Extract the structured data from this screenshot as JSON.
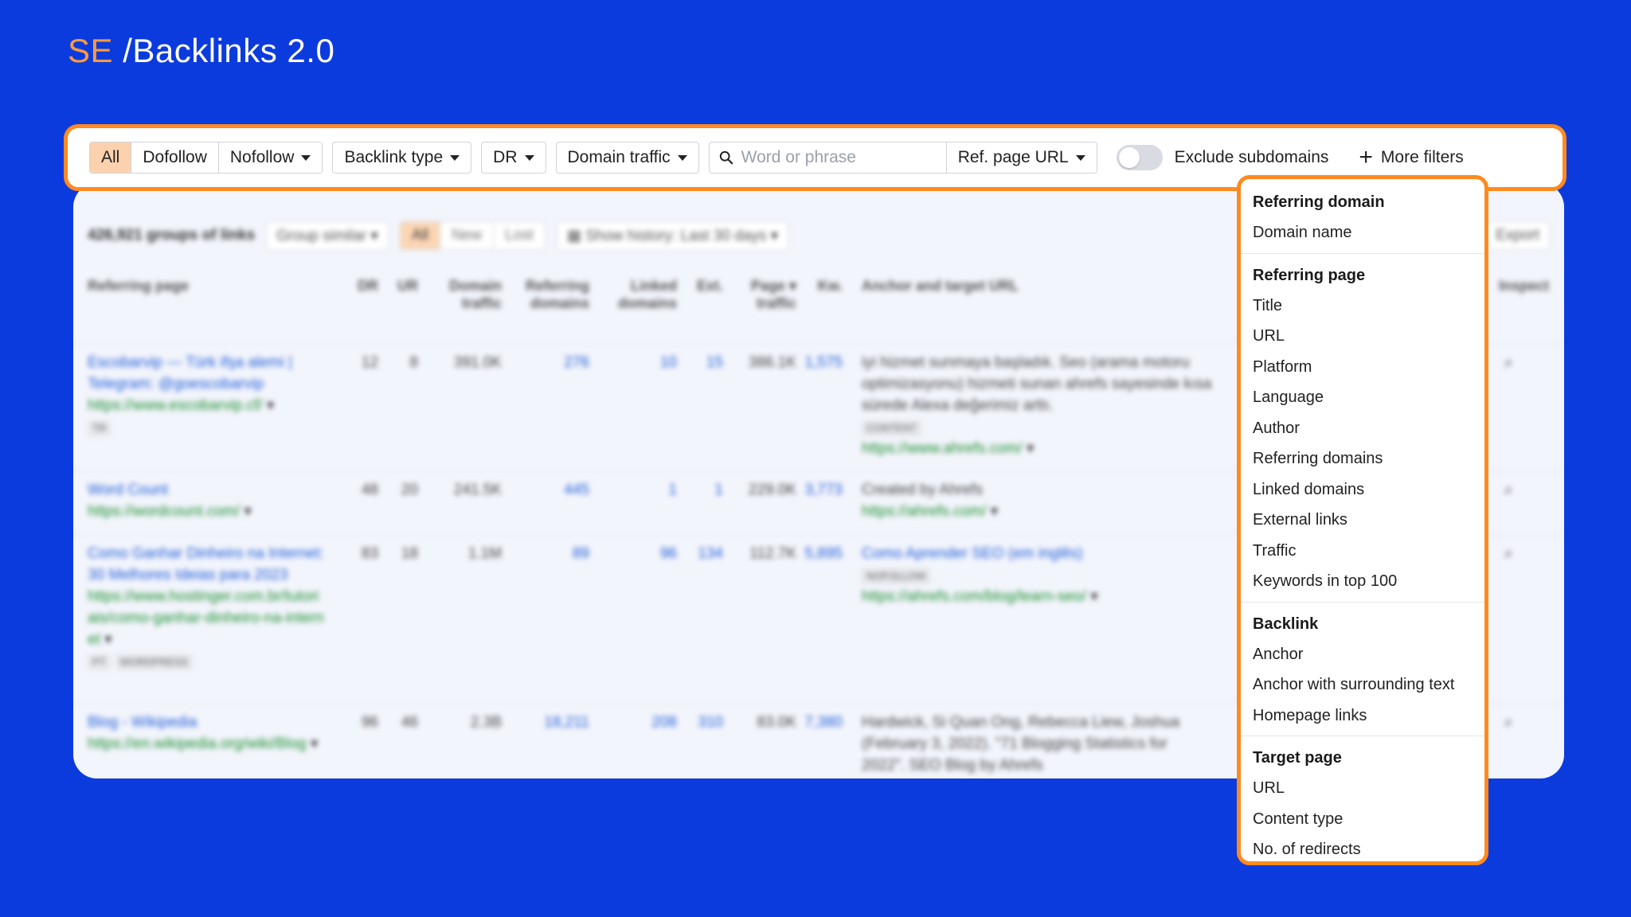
{
  "title": {
    "prefix": "SE",
    "rest": " /Backlinks 2.0"
  },
  "filter_bar": {
    "link_type_segments": [
      "All",
      "Dofollow",
      "Nofollow"
    ],
    "backlink_type": "Backlink type",
    "dr": "DR",
    "domain_traffic": "Domain traffic",
    "search_placeholder": "Word or phrase",
    "search_scope": "Ref. page URL",
    "exclude_subdomains": "Exclude subdomains",
    "more_filters": "More filters"
  },
  "table": {
    "groups_count": "426,921 groups of links",
    "group_similar": "Group similar",
    "status_segments": [
      "All",
      "New",
      "Lost"
    ],
    "history": "Show history: Last 30 days",
    "export": "Export",
    "columns": {
      "referring_page": "Referring page",
      "dr": "DR",
      "ur": "UR",
      "domain_traffic_1": "Domain",
      "domain_traffic_2": "traffic",
      "referring_domains_1": "Referring",
      "referring_domains_2": "domains",
      "linked_domains_1": "Linked",
      "linked_domains_2": "domains",
      "ext": "Ext.",
      "page_traffic_1": "Page",
      "page_traffic_2": "traffic",
      "kw": "Kw.",
      "anchor": "Anchor and target URL",
      "inspect": "Inspect"
    },
    "rows": [
      {
        "title": "Escobarvip — Türk ifşa alemi | Telegram: @goescobarvip",
        "url": "https://www.escobarvip.cf/",
        "tags": [
          "TR"
        ],
        "dr": "12",
        "ur": "8",
        "domain_traffic": "391.0K",
        "ref_domains": "276",
        "linked_domains": "10",
        "ext": "15",
        "page_traffic": "386.1K",
        "kw": "1,575",
        "anchor_text": "iyi hizmet sunmaya başladık. Seo (arama motoru optimizasyonu) hizmeti sunan ahrefs sayesinde kısa sürede Alexa değerimiz arttı.",
        "anchor_tag": "CONTENT",
        "target_url": "https://www.ahrefs.com/"
      },
      {
        "title": "Word Count",
        "url": "https://wordcount.com/",
        "tags": [],
        "dr": "48",
        "ur": "20",
        "domain_traffic": "241.5K",
        "ref_domains": "445",
        "linked_domains": "1",
        "ext": "1",
        "page_traffic": "229.0K",
        "kw": "3,773",
        "anchor_text": "Created by Ahrefs",
        "anchor_tag": "",
        "target_url": "https://ahrefs.com/"
      },
      {
        "title": "Como Ganhar Dinheiro na Internet: 30 Melhores Ideias para 2023",
        "url": "https://www.hostinger.com.br/tutoriais/como-ganhar-dinheiro-na-internet",
        "tags": [
          "PT",
          "WORDPRESS"
        ],
        "dr": "83",
        "ur": "18",
        "domain_traffic": "1.1M",
        "ref_domains": "89",
        "linked_domains": "96",
        "ext": "134",
        "page_traffic": "112.7K",
        "kw": "5,895",
        "anchor_text": "Como Aprender SEO (em inglês)",
        "anchor_tag": "NOFOLLOW",
        "target_url": "https://ahrefs.com/blog/learn-seo/"
      },
      {
        "title": "Blog - Wikipedia",
        "url": "https://en.wikipedia.org/wiki/Blog",
        "tags": [],
        "dr": "96",
        "ur": "46",
        "domain_traffic": "2.3B",
        "ref_domains": "18,211",
        "linked_domains": "208",
        "ext": "310",
        "page_traffic": "83.0K",
        "kw": "7,380",
        "anchor_text": "Hardwick, Si Quan Ong, Rebecca Liew, Joshua (February 3, 2022). \"71 Blogging Statistics for 2022\". SEO Blog by Ahrefs",
        "anchor_tag": "",
        "target_url": ""
      }
    ]
  },
  "dropdown": {
    "sections": [
      {
        "heading": "Referring domain",
        "items": [
          "Domain name"
        ]
      },
      {
        "heading": "Referring page",
        "items": [
          "Title",
          "URL",
          "Platform",
          "Language",
          "Author",
          "Referring domains",
          "Linked domains",
          "External links",
          "Traffic",
          "Keywords in top 100"
        ]
      },
      {
        "heading": "Backlink",
        "items": [
          "Anchor",
          "Anchor with surrounding text",
          "Homepage links"
        ]
      },
      {
        "heading": "Target page",
        "items": [
          "URL",
          "Content type",
          "No. of redirects"
        ]
      }
    ]
  },
  "colors": {
    "background": "#0C3BDD",
    "accent": "#FF8A1F",
    "title_prefix": "#FF9A3C",
    "active_segment": "#FCD2AE"
  }
}
